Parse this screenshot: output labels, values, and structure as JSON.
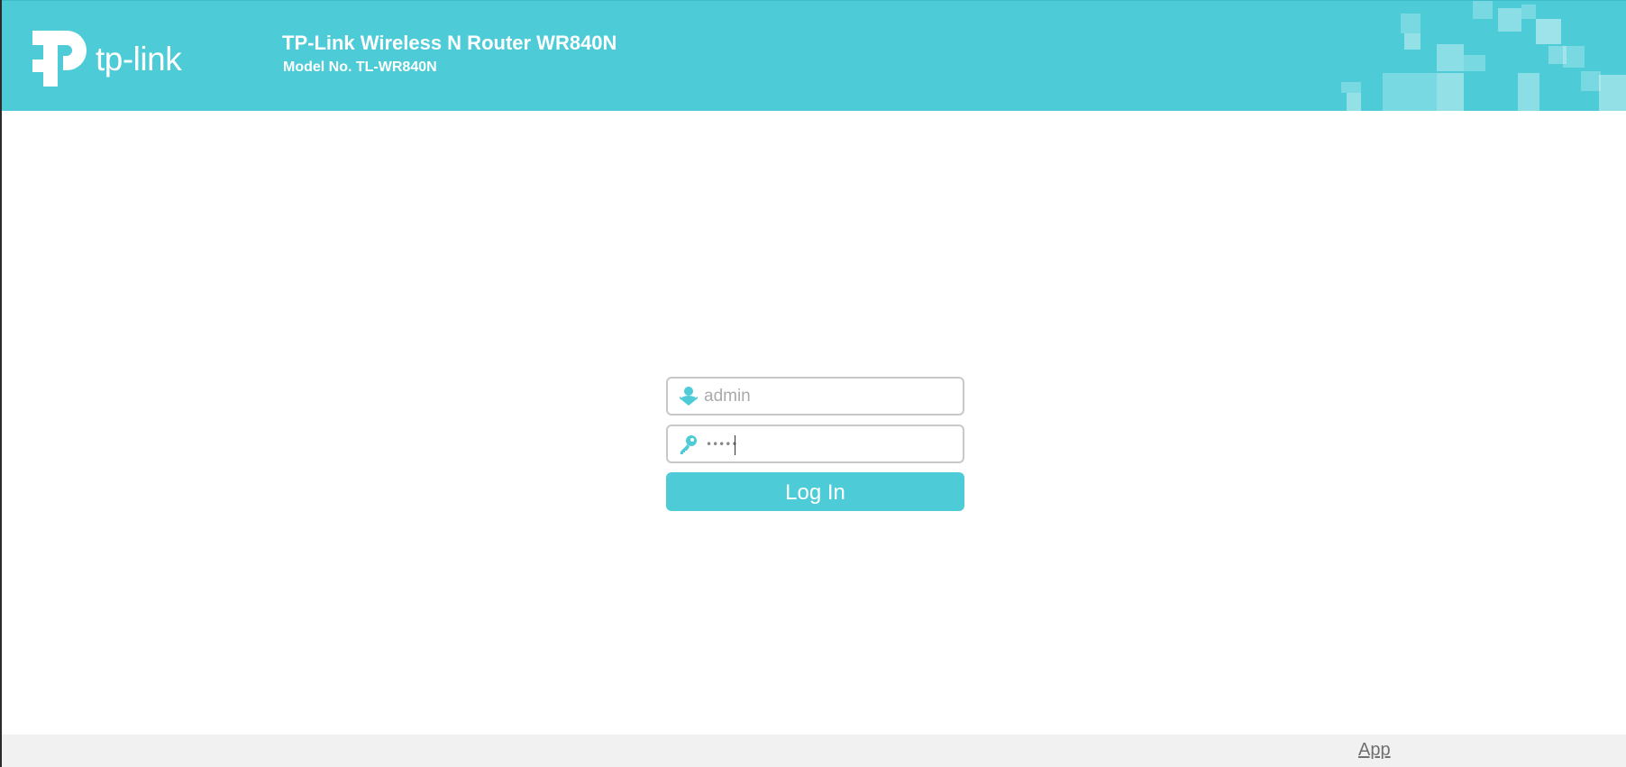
{
  "header": {
    "logo_text": "tp-link",
    "title": "TP-Link Wireless N Router WR840N",
    "model": "Model No. TL-WR840N"
  },
  "login": {
    "username": {
      "placeholder": "admin",
      "value": "",
      "icon": "user-icon"
    },
    "password": {
      "masked_value": "•••••",
      "icon": "key-icon"
    },
    "button_label": "Log In"
  },
  "footer": {
    "app_link": "App"
  },
  "colors": {
    "brand": "#4dccd8",
    "footer_bg": "#f1f1f1",
    "field_border": "#c8c8c8"
  }
}
